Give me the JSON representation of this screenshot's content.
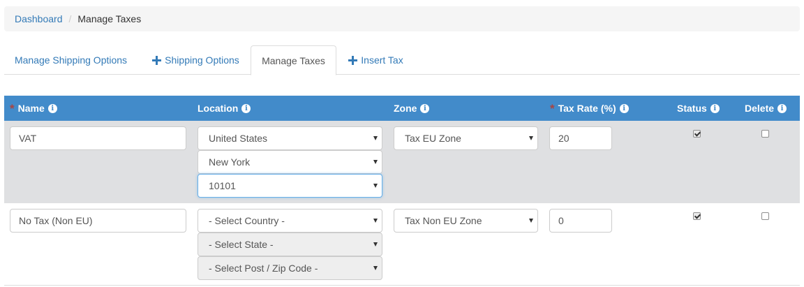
{
  "breadcrumb": {
    "home": "Dashboard",
    "separator": "/",
    "current": "Manage Taxes"
  },
  "tabs": [
    {
      "label": "Manage Shipping Options",
      "icon": ""
    },
    {
      "label": "Shipping Options",
      "icon": "plus-icon"
    },
    {
      "label": "Manage Taxes",
      "icon": "",
      "active": true
    },
    {
      "label": "Insert Tax",
      "icon": "plus-icon"
    }
  ],
  "table": {
    "headers": {
      "name": "Name",
      "location": "Location",
      "zone": "Zone",
      "tax_rate": "Tax Rate (%)",
      "status": "Status",
      "delete": "Delete"
    },
    "required_marker": "*",
    "info_glyph": "i",
    "rows": [
      {
        "name": "VAT",
        "country": "United States",
        "state": "New York",
        "zip": "10101",
        "zone": "Tax EU Zone",
        "rate": "20",
        "status_checked": true,
        "delete_checked": false
      },
      {
        "name": "No Tax (Non EU)",
        "country": "- Select Country -",
        "state": "- Select State -",
        "zip": "- Select Post / Zip Code -",
        "zone": "Tax Non EU Zone",
        "rate": "0",
        "status_checked": true,
        "delete_checked": false
      }
    ]
  },
  "colors": {
    "header_bg": "#428bca",
    "link": "#337ab7",
    "required": "#a94442",
    "row_alt_bg": "#dfe0e2"
  }
}
